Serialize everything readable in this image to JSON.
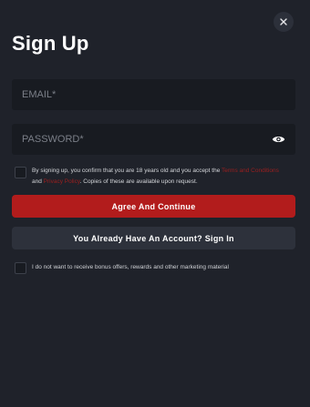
{
  "modal": {
    "title": "Sign Up",
    "close_icon": "close-icon"
  },
  "form": {
    "email": {
      "placeholder": "EMAIL*",
      "value": ""
    },
    "password": {
      "placeholder": "PASSWORD*",
      "value": "",
      "toggle_icon": "eye-icon"
    },
    "consent": {
      "text_before": "By signing up, you confirm that you are 18 years old and you accept the ",
      "terms_link": "Terms and Conditions",
      "and_text": " and ",
      "privacy_link": "Privacy Policy",
      "text_after": ". Copies of these are available upon request.",
      "checked": false
    },
    "primary_button": "Agree And Continue",
    "secondary_button": "You Already Have An Account? Sign In",
    "marketing": {
      "label": "I do not want to receive bonus offers, rewards and other marketing material",
      "checked": false
    }
  },
  "colors": {
    "background": "#1f222a",
    "field_background": "#181b21",
    "primary": "#b21c1c",
    "secondary": "#2d313b",
    "link": "#9c1f1f"
  }
}
